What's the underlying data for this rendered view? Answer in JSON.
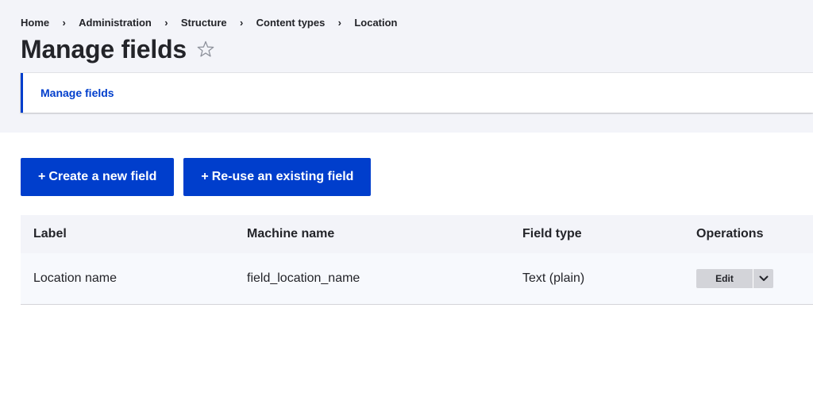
{
  "breadcrumb": {
    "items": [
      "Home",
      "Administration",
      "Structure",
      "Content types",
      "Location"
    ],
    "separator": "›"
  },
  "page": {
    "title": "Manage fields",
    "star_icon": "star-outline-icon"
  },
  "tabs": [
    {
      "label": "Manage fields",
      "active": true
    }
  ],
  "actions": {
    "create_label": "Create a new field",
    "reuse_label": "Re-use an existing field",
    "plus_glyph": "+"
  },
  "table": {
    "headers": [
      "Label",
      "Machine name",
      "Field type",
      "Operations"
    ],
    "rows": [
      {
        "label": "Location name",
        "machine_name": "field_location_name",
        "field_type": "Text (plain)",
        "operation": "Edit",
        "toggle_icon": "chevron-down-icon"
      }
    ]
  },
  "colors": {
    "accent": "#003ecc",
    "header_bg": "#f3f4f9",
    "text": "#232429",
    "button_gray": "#d3d4d9"
  }
}
